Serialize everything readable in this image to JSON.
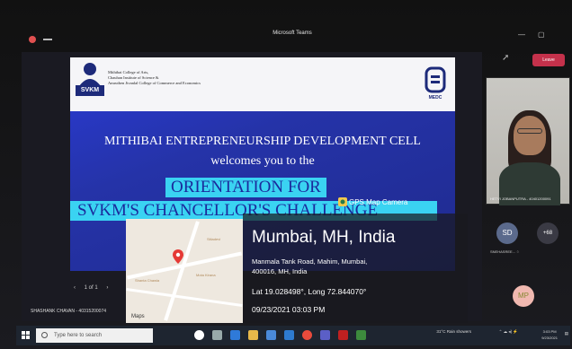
{
  "window": {
    "title": "Microsoft Teams"
  },
  "toolbar": {
    "leave_label": "Leave"
  },
  "slide": {
    "org_line1": "Mithibai College of Arts,",
    "org_line2": "Chauhan Institute of Science &",
    "org_line3": "Amrutben Jivanlal College of Commerce and Economics",
    "logo_text": "SVKM",
    "medc_text": "MEDC",
    "line1": "MITHIBAI ENTREPRENEURSHIP DEVELOPMENT CELL",
    "line2": "welcomes you to the",
    "line3": "ORIENTATION FOR",
    "line4": "SVKM'S CHANCELLOR'S CHALLENGE"
  },
  "pager": {
    "label": "1 of 1"
  },
  "presenter": {
    "name": "SHASHANK CHAVAN - 40315200074"
  },
  "gps": {
    "camera_label": "GPS Map Camera",
    "city": "Mumbai, MH, India",
    "address_line1": "Manmala Tank Road, Mahim, Mumbai,",
    "address_line2": "400016, MH, India",
    "coords": "Lat 19.028498°, Long 72.844070°",
    "datetime": "09/23/2021 03:03 PM",
    "maps_brand": "Maps"
  },
  "participants": {
    "video_name": "HETVI JOBANPUTRA - 40401200091",
    "sd_initials": "SD",
    "sd_name": "SNEHASREE... ♘",
    "more_label": "+68",
    "mp_initials": "MP"
  },
  "taskbar": {
    "search_placeholder": "Type here to search",
    "weather": "31°C  Rain showers",
    "time": "3:03 PM",
    "date": "9/23/2021"
  },
  "colors": {
    "slide_blue": "#2533a8",
    "highlight": "#3ad3f2",
    "leave_red": "#c4314b"
  }
}
